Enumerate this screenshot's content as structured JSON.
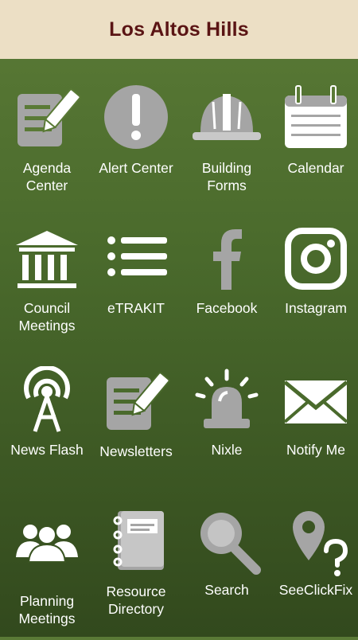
{
  "header": {
    "title": "Los Altos Hills"
  },
  "tiles": [
    {
      "label": "Agenda\nCenter",
      "icon": "agenda-icon"
    },
    {
      "label": "Alert Center",
      "icon": "alert-icon"
    },
    {
      "label": "Building\nForms",
      "icon": "hardhat-icon"
    },
    {
      "label": "Calendar",
      "icon": "calendar-icon"
    },
    {
      "label": "Council\nMeetings",
      "icon": "courthouse-icon"
    },
    {
      "label": "eTRAKIT",
      "icon": "list-icon"
    },
    {
      "label": "Facebook",
      "icon": "facebook-icon"
    },
    {
      "label": "Instagram",
      "icon": "instagram-icon"
    },
    {
      "label": "News Flash",
      "icon": "radio-tower-icon"
    },
    {
      "label": "Newsletters",
      "icon": "newsletter-icon"
    },
    {
      "label": "Nixle",
      "icon": "siren-icon"
    },
    {
      "label": "Notify Me",
      "icon": "envelope-icon"
    },
    {
      "label": "Planning\nMeetings",
      "icon": "people-icon"
    },
    {
      "label": "Resource\nDirectory",
      "icon": "notebook-icon"
    },
    {
      "label": "Search",
      "icon": "search-icon"
    },
    {
      "label": "SeeClickFix",
      "icon": "map-pin-question-icon"
    }
  ]
}
